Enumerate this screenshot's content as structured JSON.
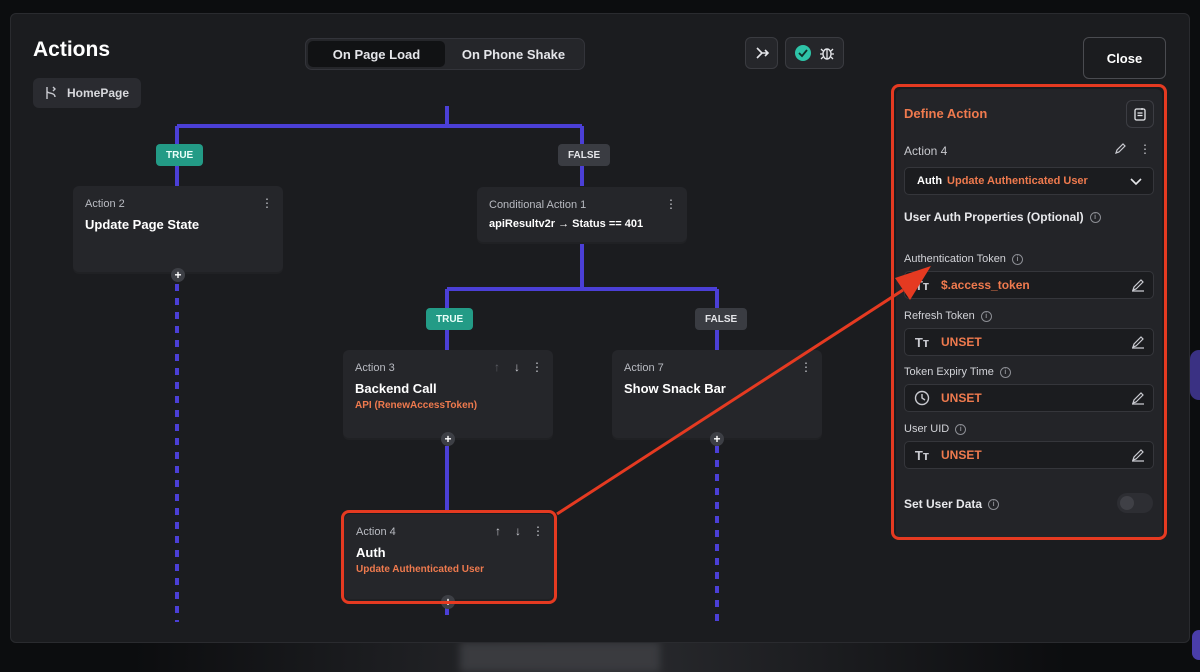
{
  "header": {
    "title": "Actions",
    "page_chip": "HomePage",
    "tabs": [
      "On Page Load",
      "On Phone Shake"
    ],
    "close_label": "Close"
  },
  "flow": {
    "branch_true": "TRUE",
    "branch_false": "FALSE",
    "nodes": {
      "action2": {
        "sub": "Action 2",
        "title": "Update Page State"
      },
      "cond1": {
        "sub": "Conditional Action 1",
        "condition": "apiResultv2r → Status  ==  401"
      },
      "action3": {
        "sub": "Action 3",
        "title": "Backend Call",
        "detail": "API (RenewAccessToken)"
      },
      "action7": {
        "sub": "Action 7",
        "title": "Show Snack Bar"
      },
      "action4": {
        "sub": "Action 4",
        "title": "Auth",
        "detail": "Update Authenticated User"
      }
    }
  },
  "panel": {
    "header": "Define Action",
    "action_name": "Action 4",
    "select": {
      "category": "Auth",
      "value": "Update Authenticated User"
    },
    "section_title": "User Auth Properties (Optional)",
    "fields": [
      {
        "label": "Authentication Token",
        "value": "$.access_token",
        "type_icon": "text-type-icon"
      },
      {
        "label": "Refresh Token",
        "value": "UNSET",
        "type_icon": "text-type-icon"
      },
      {
        "label": "Token Expiry Time",
        "value": "UNSET",
        "type_icon": "clock-icon"
      },
      {
        "label": "User UID",
        "value": "UNSET",
        "type_icon": "text-type-icon"
      }
    ],
    "set_user_data": "Set User Data",
    "set_user_data_on": false
  },
  "colors": {
    "accent": "#ef7a4e",
    "connector": "#4b3fd6",
    "true_badge": "#239b86",
    "highlight": "#e53a21"
  }
}
